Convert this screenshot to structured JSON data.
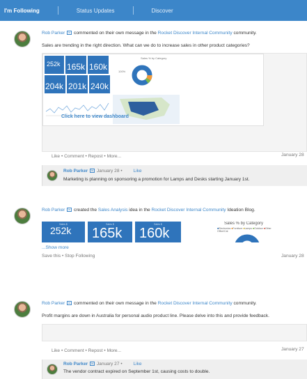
{
  "tabs": [
    {
      "label": "I'm Following",
      "active": true
    },
    {
      "label": "Status Updates",
      "active": false
    },
    {
      "label": "Discover",
      "active": false
    }
  ],
  "feed": [
    {
      "author": "Rob Parker",
      "action_text": " commented on their own message in the ",
      "place": "Rocket Discover Internal Community",
      "place_suffix": " community.",
      "message": "Sales are trending in the right direction. What can we do to increase sales in other product categories?",
      "dashboard_overlay": "Click here to view dashboard",
      "dashboard_tiles": [
        "252k",
        "165k",
        "160k",
        "204k",
        "201k",
        "240k"
      ],
      "dashboard_chart_title": "Sales % by Category",
      "dashboard_pct": "100%",
      "actions": [
        "Like",
        "Comment",
        "Repost",
        "More..."
      ],
      "date": "January 28",
      "reply": {
        "author": "Rob Parker",
        "date": "January 28",
        "like_label": "Like",
        "text": "Marketing is planning on sponsoring a promotion for Lamps and Desks starting January 1st."
      }
    },
    {
      "author": "Rob Parker",
      "action_text": " created the ",
      "idea": "Sales Analysis",
      "idea_mid": " idea in the ",
      "place": "Rocket Discover Internal Community",
      "place_suffix": " Ideation Blog.",
      "tiles": [
        {
          "label": "Sales $",
          "value": "252k"
        },
        {
          "label": "Sales $",
          "value": "165k"
        },
        {
          "label": "Sales $",
          "value": "160k"
        }
      ],
      "chart_title": "Sales % by Category",
      "chart_legend": [
        "Electronics",
        "Furniture",
        "Lamps",
        "Outdoor",
        "Other"
      ],
      "chart_legend_colors": [
        "#2f74bb",
        "#f29a38",
        "#e0c441",
        "#7cb84d",
        "#d75a4a"
      ],
      "chart_legend_extra": "Office/Cat",
      "chart_side_labels": [
        "100%/%",
        "Grand/%"
      ],
      "show_more": "...Show more",
      "actions": [
        "Save this",
        "Stop Following"
      ],
      "date": "January 28"
    },
    {
      "author": "Rob Parker",
      "action_text": " commented on their own message in the ",
      "place": "Rocket Discover Internal Community",
      "place_suffix": " community.",
      "message": "Profit margins are down in Australia for personal audio product line. Please delve into this and provide feedback.",
      "actions": [
        "Like",
        "Comment",
        "Repost",
        "More..."
      ],
      "date": "January 27",
      "reply": {
        "author": "Rob Parker",
        "date": "January 27",
        "like_label": "Like",
        "text": "The vendor contract expired on September 1st, causing costs to double."
      }
    }
  ],
  "sep": " • ",
  "badge_glyph": "in",
  "colors": {
    "accent": "#3c86c9",
    "tile": "#2f74bb"
  }
}
